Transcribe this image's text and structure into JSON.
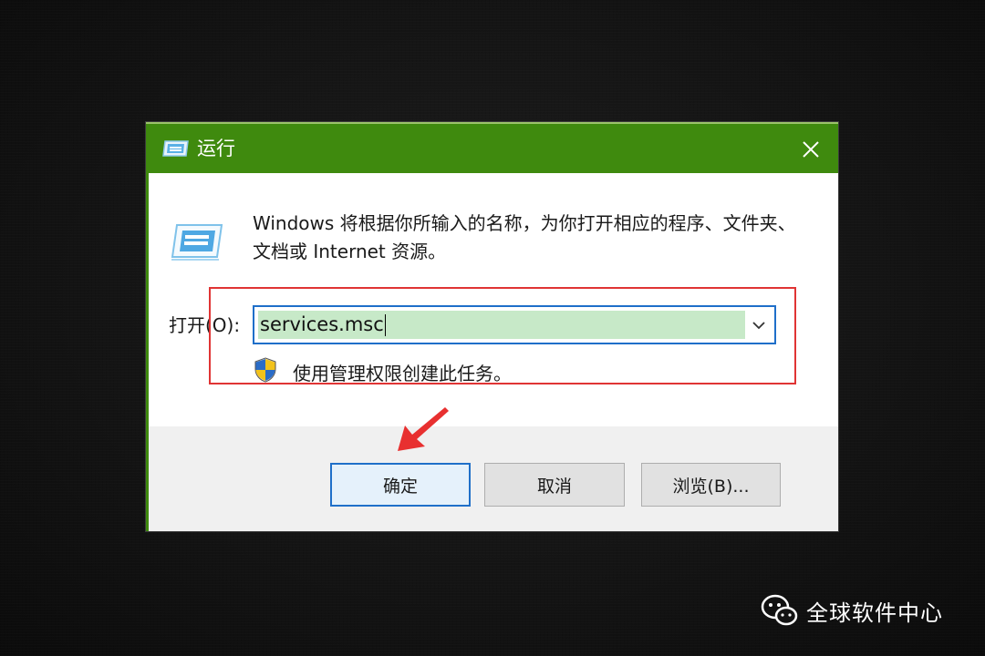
{
  "dialog": {
    "title": "运行",
    "description": "Windows 将根据你所输入的名称，为你打开相应的程序、文件夹、文档或 Internet 资源。",
    "open_label": "打开(O):",
    "input_value": "services.msc",
    "admin_note": "使用管理权限创建此任务。",
    "buttons": {
      "ok": "确定",
      "cancel": "取消",
      "browse": "浏览(B)..."
    },
    "title_bar_color": "#3f8a0e",
    "highlight_color": "#e03434"
  },
  "icons": {
    "title": "run-icon",
    "close": "close-icon",
    "dropdown": "chevron-down-icon",
    "uac": "uac-shield-icon"
  },
  "watermark": {
    "text": "全球软件中心",
    "icon": "wechat-icon"
  }
}
